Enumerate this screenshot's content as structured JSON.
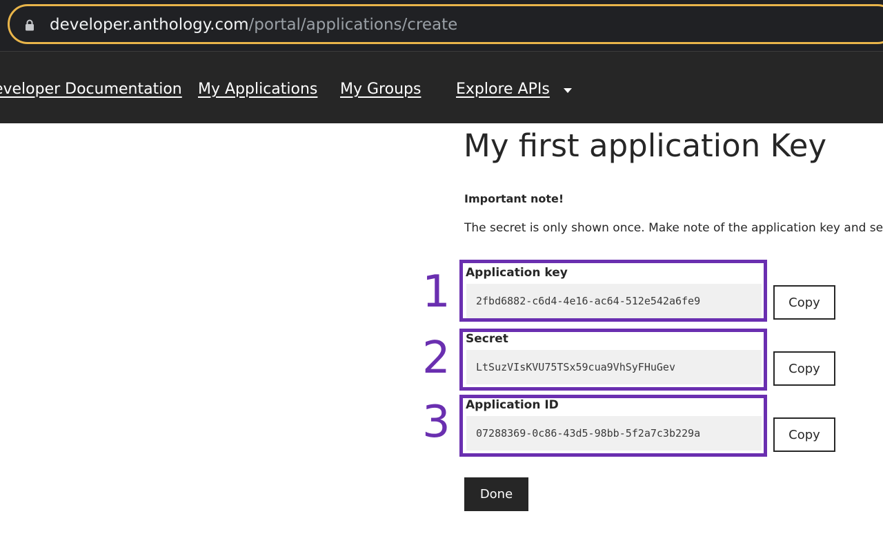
{
  "browser": {
    "url_domain": "developer.anthology.com",
    "url_path": "/portal/applications/create"
  },
  "nav": {
    "items": [
      {
        "label": "Developer Documentation"
      },
      {
        "label": "My Applications"
      },
      {
        "label": "My Groups"
      },
      {
        "label": "Explore APIs"
      }
    ]
  },
  "main": {
    "title": "My first application Key",
    "note_heading": "Important note!",
    "note_text": "The secret is only shown once. Make note of the application key and secret",
    "fields": [
      {
        "number": "1",
        "label": "Application key",
        "value": "2fbd6882-c6d4-4e16-ac64-512e542a6fe9",
        "copy_label": "Copy"
      },
      {
        "number": "2",
        "label": "Secret",
        "value": "LtSuzVIsKVU75TSx59cua9VhSyFHuGev",
        "copy_label": "Copy"
      },
      {
        "number": "3",
        "label": "Application ID",
        "value": "07288369-0c86-43d5-98bb-5f2a7c3b229a",
        "copy_label": "Copy"
      }
    ],
    "done_label": "Done"
  },
  "colors": {
    "annotation": "#6a2fb0",
    "url_border": "#e9b54a",
    "nav_background": "#262626",
    "browser_background": "#202124"
  }
}
